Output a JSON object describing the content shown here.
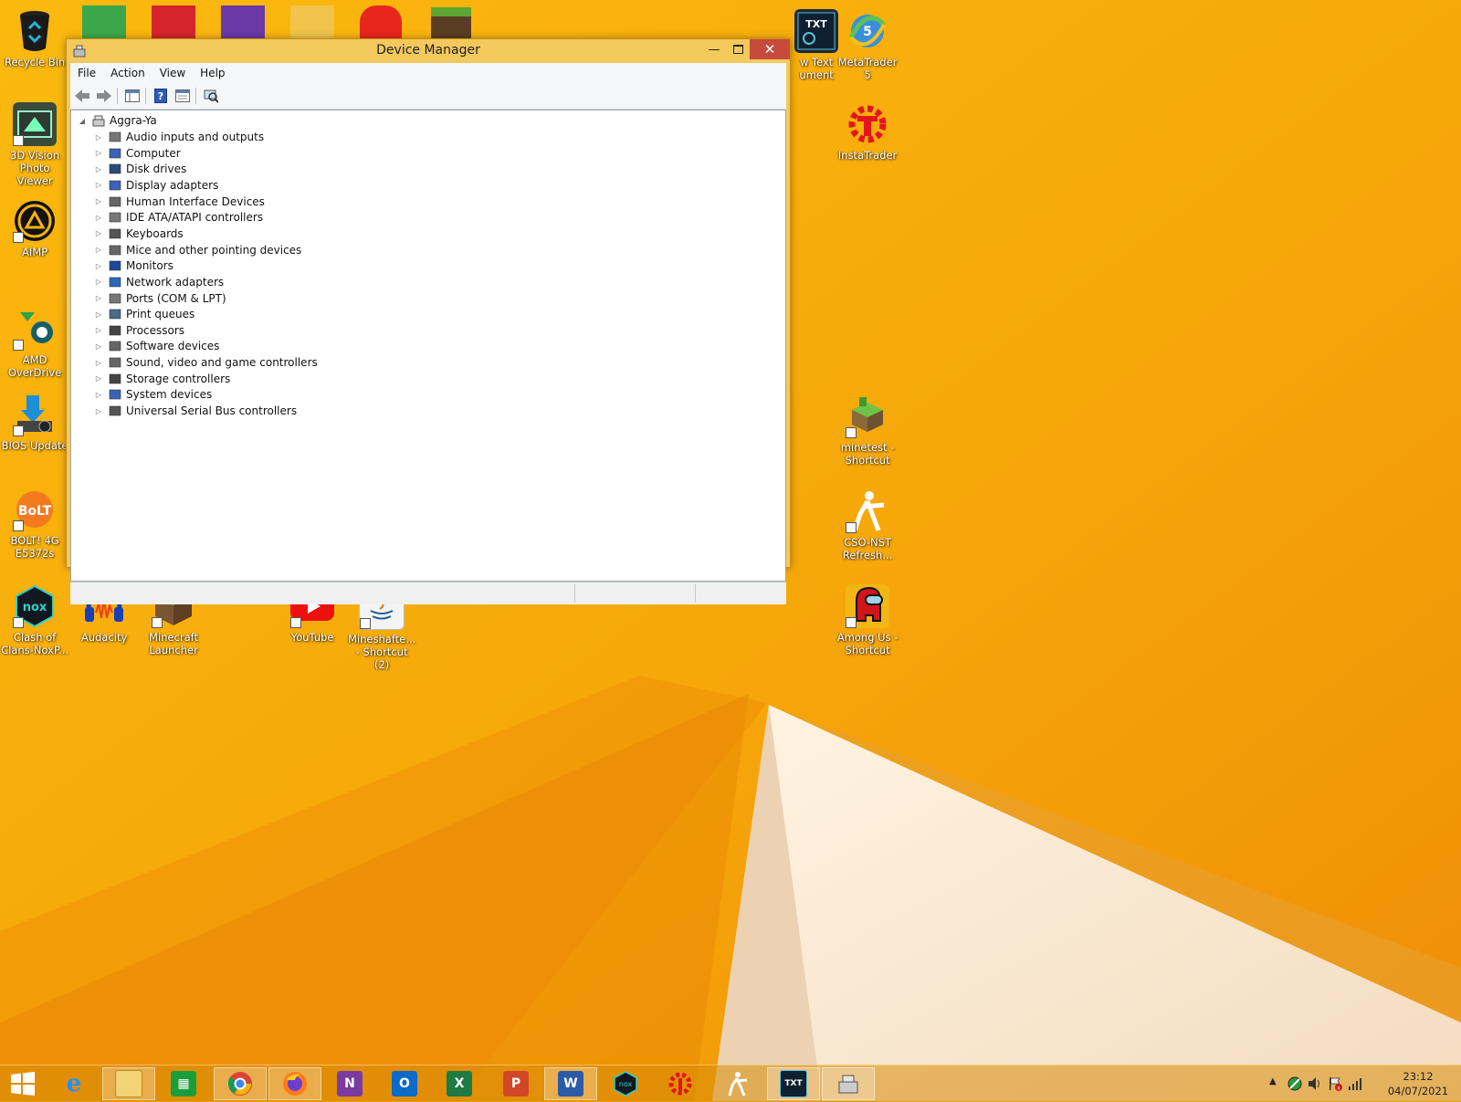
{
  "desktop": {
    "icons": [
      {
        "label": "Recycle Bin",
        "icon": "recycle-bin-icon"
      },
      {
        "label": "3D Vision Photo Viewer",
        "icon": "3d-vision-icon"
      },
      {
        "label": "AIMP",
        "icon": "aimp-icon"
      },
      {
        "label": "AMD OverDrive",
        "icon": "amd-overdrive-icon"
      },
      {
        "label": "BIOS Update",
        "icon": "bios-update-icon"
      },
      {
        "label": "BOLT! 4G E5372s",
        "icon": "bolt-icon"
      },
      {
        "label": "Clash of Clans-NoxP...",
        "icon": "nox-icon"
      },
      {
        "label": "Audacity",
        "icon": "audacity-icon"
      },
      {
        "label": "Minecraft Launcher",
        "icon": "minecraft-icon"
      },
      {
        "label": "YouTube",
        "icon": "youtube-icon"
      },
      {
        "label": "Mineshafte... - Shortcut (2)",
        "icon": "java-icon"
      },
      {
        "label": "w Text ument",
        "icon": "text-document-icon"
      },
      {
        "label": "MetaTrader 5",
        "icon": "metatrader-icon"
      },
      {
        "label": "InstaTrader",
        "icon": "instatrader-icon"
      },
      {
        "label": "minetest - Shortcut",
        "icon": "minetest-icon"
      },
      {
        "label": "CSO-NST Refresh...",
        "icon": "counter-strike-icon"
      },
      {
        "label": "Among Us - Shortcut",
        "icon": "among-us-icon"
      }
    ]
  },
  "window": {
    "title": "Device Manager",
    "menu": [
      "File",
      "Action",
      "View",
      "Help"
    ],
    "tree": {
      "root": "Aggra-Ya",
      "items": [
        "Audio inputs and outputs",
        "Computer",
        "Disk drives",
        "Display adapters",
        "Human Interface Devices",
        "IDE ATA/ATAPI controllers",
        "Keyboards",
        "Mice and other pointing devices",
        "Monitors",
        "Network adapters",
        "Ports (COM & LPT)",
        "Print queues",
        "Processors",
        "Software devices",
        "Sound, video and game controllers",
        "Storage controllers",
        "System devices",
        "Universal Serial Bus controllers"
      ]
    }
  },
  "taskbar": {
    "apps": [
      "start",
      "internet-explorer",
      "file-explorer",
      "store",
      "chrome",
      "firefox",
      "onenote",
      "outlook",
      "excel",
      "powerpoint",
      "word",
      "nox",
      "instatrader",
      "counter-strike",
      "txt-app",
      "device-manager"
    ],
    "clock": {
      "time": "23:12",
      "date": "04/07/2021"
    }
  },
  "colors": {
    "accent": "#f7b409",
    "close": "#c74b3c",
    "title_bg": "#f3c95d"
  }
}
